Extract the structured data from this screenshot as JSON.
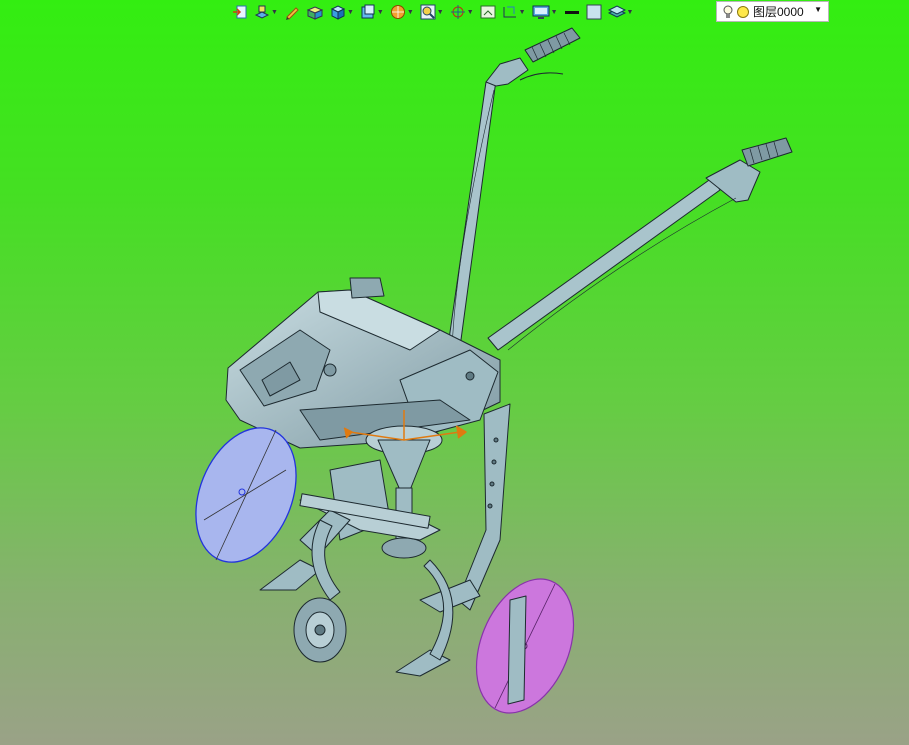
{
  "toolbar": {
    "tools": [
      {
        "icon": "insert-icon",
        "dropdown": false
      },
      {
        "icon": "layers-stack-icon",
        "dropdown": true
      },
      {
        "icon": "sketch-pencil-icon",
        "dropdown": false
      },
      {
        "icon": "shaded-box-icon",
        "dropdown": false
      },
      {
        "icon": "render-cube-icon",
        "dropdown": true
      },
      {
        "icon": "view-cube-icon",
        "dropdown": true
      },
      {
        "icon": "sphere-icon",
        "dropdown": true
      },
      {
        "icon": "zoom-fit-icon",
        "dropdown": true
      },
      {
        "icon": "target-icon",
        "dropdown": true
      },
      {
        "icon": "frame-icon",
        "dropdown": false
      },
      {
        "icon": "dimension-icon",
        "dropdown": true
      },
      {
        "icon": "display-icon",
        "dropdown": true
      },
      {
        "icon": "line-color-icon",
        "dropdown": false
      },
      {
        "icon": "fill-color-icon",
        "dropdown": false
      },
      {
        "icon": "layer-manager-icon",
        "dropdown": true
      }
    ],
    "layer_selector": {
      "value": "图层0000",
      "icon": "light-bulb-icon"
    }
  },
  "colors": {
    "background_top": "#33ee11",
    "background_bottom": "#9aa287",
    "model_fill": "#9fbcc4",
    "highlight_face": "#cc77dd",
    "selected_face": "#a8b6ee"
  }
}
